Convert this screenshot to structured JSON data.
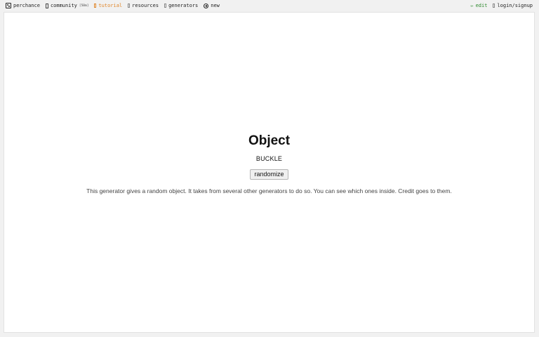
{
  "nav": {
    "left": [
      {
        "label": "perchance",
        "icon": "die-icon"
      },
      {
        "label": "community",
        "icon": "box-icon",
        "badge": "[50m]"
      },
      {
        "label": "tutorial",
        "icon": "box-icon"
      },
      {
        "label": "resources",
        "icon": "box-icon"
      },
      {
        "label": "generators",
        "icon": "box-icon"
      },
      {
        "label": "new",
        "icon": "plus-circle-icon"
      }
    ],
    "right": [
      {
        "label": "edit",
        "icon": "pencil-icon",
        "glyph": "✏"
      },
      {
        "label": "login/signup",
        "icon": "box-icon"
      }
    ]
  },
  "colors": {
    "tutorial": "#e0872b",
    "edit": "#2f8a2f",
    "background": "#f1f1f1",
    "frame": "#ffffff"
  },
  "main": {
    "title": "Object",
    "result": "BUCKLE",
    "button_label": "randomize",
    "description": "This generator gives a random object. It takes from several other generators to do so. You can see which ones inside. Credit goes to them."
  }
}
